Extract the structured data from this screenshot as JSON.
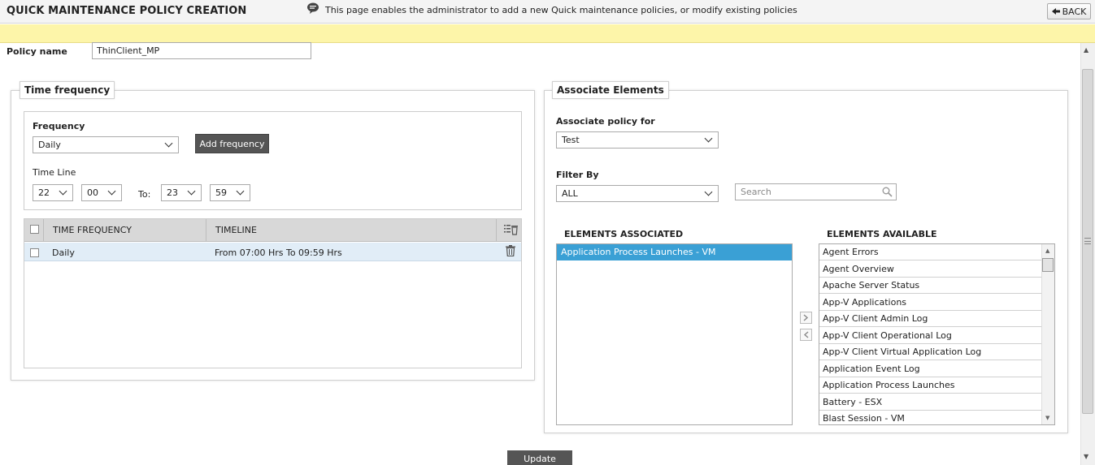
{
  "header": {
    "title": "QUICK MAINTENANCE POLICY CREATION",
    "back_label": "BACK"
  },
  "info": {
    "text": "This page enables the administrator to add a new Quick maintenance policies, or modify existing policies"
  },
  "policy": {
    "label": "Policy name",
    "value": "ThinClient_MP"
  },
  "time_frequency": {
    "legend": "Time frequency",
    "frequency_label": "Frequency",
    "frequency_value": "Daily",
    "add_button": "Add frequency",
    "timeline_label": "Time Line",
    "from_hour": "22",
    "from_minute": "00",
    "to_label": "To:",
    "to_hour": "23",
    "to_minute": "59",
    "table": {
      "columns": [
        "TIME FREQUENCY",
        "TIMELINE"
      ],
      "rows": [
        {
          "frequency": "Daily",
          "timeline": "From 07:00 Hrs To 09:59 Hrs"
        }
      ]
    }
  },
  "associate": {
    "legend": "Associate Elements",
    "policy_for_label": "Associate policy for",
    "policy_for_value": "Test",
    "filter_label": "Filter By",
    "filter_value": "ALL",
    "search_placeholder": "Search",
    "associated_header": "ELEMENTS ASSOCIATED",
    "available_header": "ELEMENTS AVAILABLE",
    "associated": [
      "Application Process Launches - VM"
    ],
    "available": [
      "Agent Errors",
      "Agent Overview",
      "Apache Server Status",
      "App-V Applications",
      "App-V Client Admin Log",
      "App-V Client Operational Log",
      "App-V Client Virtual Application Log",
      "Application Event Log",
      "Application Process Launches",
      "Battery - ESX",
      "Blast Session - VM"
    ]
  },
  "update_label": "Update",
  "colors": {
    "info_bar": "#fdf5a9",
    "selected_item": "#3aa0d5",
    "dark_button": "#555555",
    "table_header": "#d8d8d8",
    "table_row": "#e1edf7"
  }
}
